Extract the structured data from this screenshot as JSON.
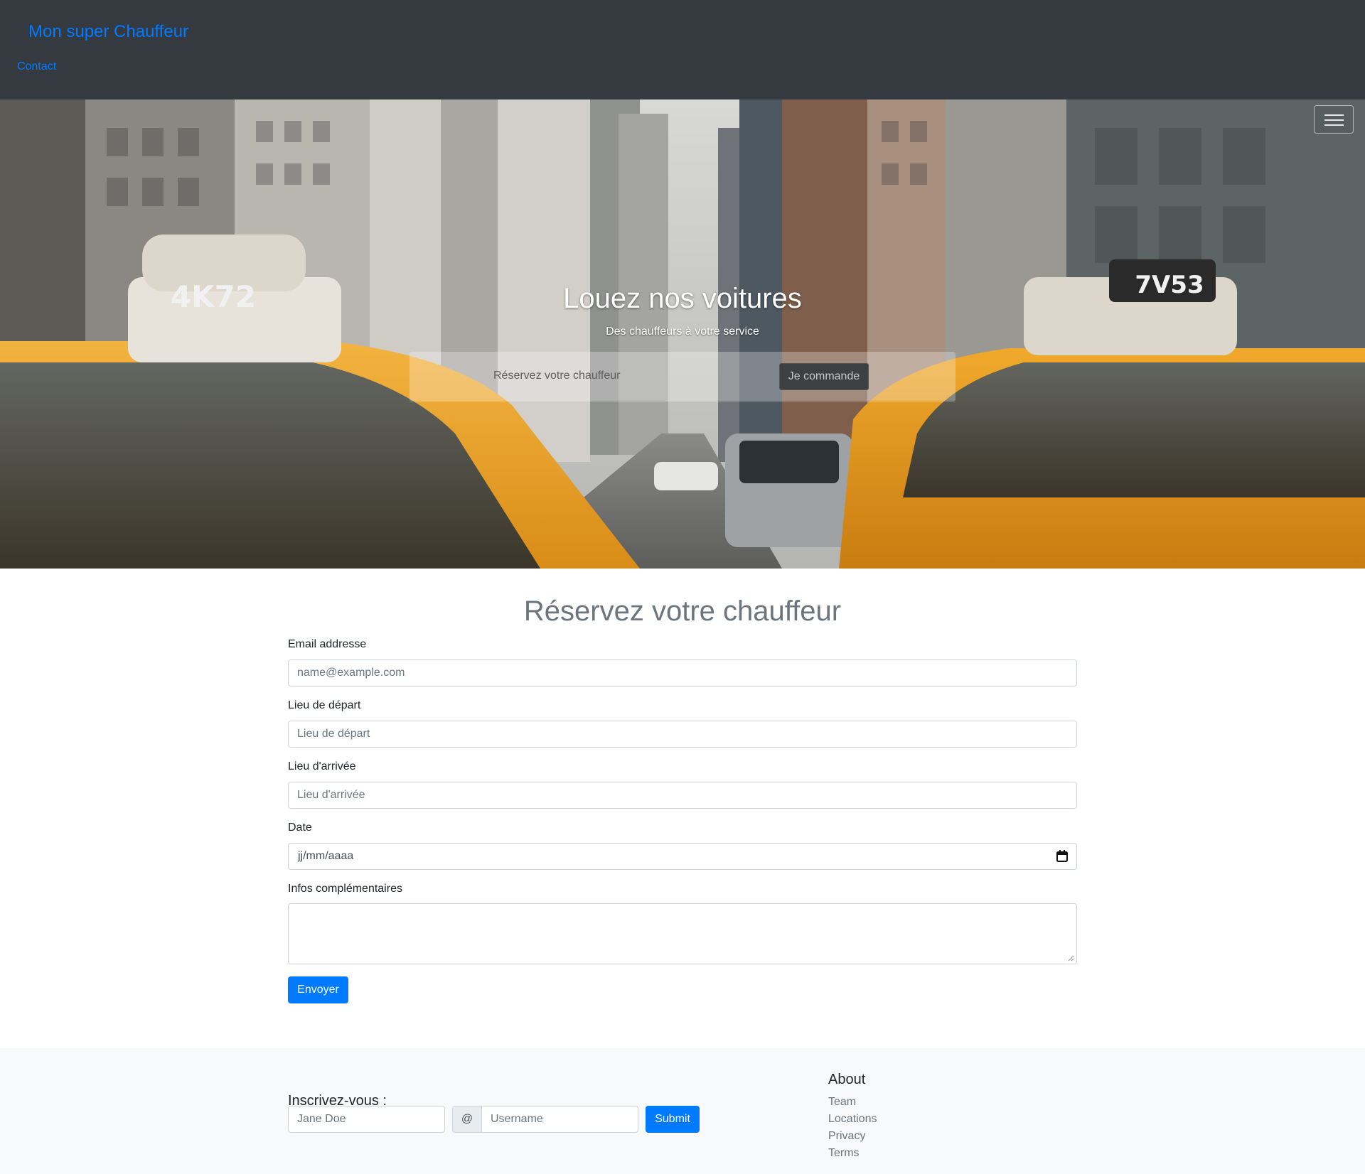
{
  "navbar": {
    "brand": "Mon super Chauffeur",
    "links": [
      "Contact"
    ],
    "toggler_icon": "hamburger-menu-icon"
  },
  "hero": {
    "title": "Louez nos voitures",
    "subtitle": "Des chauffeurs à votre service",
    "search_placeholder": "Réservez votre chauffeur",
    "button_label": "Je commande",
    "taxi_plates": [
      "4K72",
      "7V53"
    ]
  },
  "form": {
    "title": "Réservez votre chauffeur",
    "email_label": "Email addresse",
    "email_placeholder": "name@example.com",
    "depart_label": "Lieu de départ",
    "depart_placeholder": "Lieu de départ",
    "arrivee_label": "Lieu d'arrivée",
    "arrivee_placeholder": "Lieu d'arrivée",
    "date_label": "Date",
    "date_value": "jj/mm/aaaa",
    "date_icon": "calendar-icon",
    "infos_label": "Infos complémentaires",
    "submit_label": "Envoyer"
  },
  "footer": {
    "subscribe_title": "Inscrivez-vous :",
    "name_placeholder": "Jane Doe",
    "at_symbol": "@",
    "username_placeholder": "Username",
    "submit_label": "Submit",
    "about_title": "About",
    "about_links": [
      "Team",
      "Locations",
      "Privacy",
      "Terms"
    ]
  },
  "colors": {
    "navbar_bg": "#343a40",
    "link": "#007bff",
    "primary_button": "#007bff",
    "footer_bg": "#f8f9fa",
    "taxi_yellow": "#f2a92e"
  }
}
